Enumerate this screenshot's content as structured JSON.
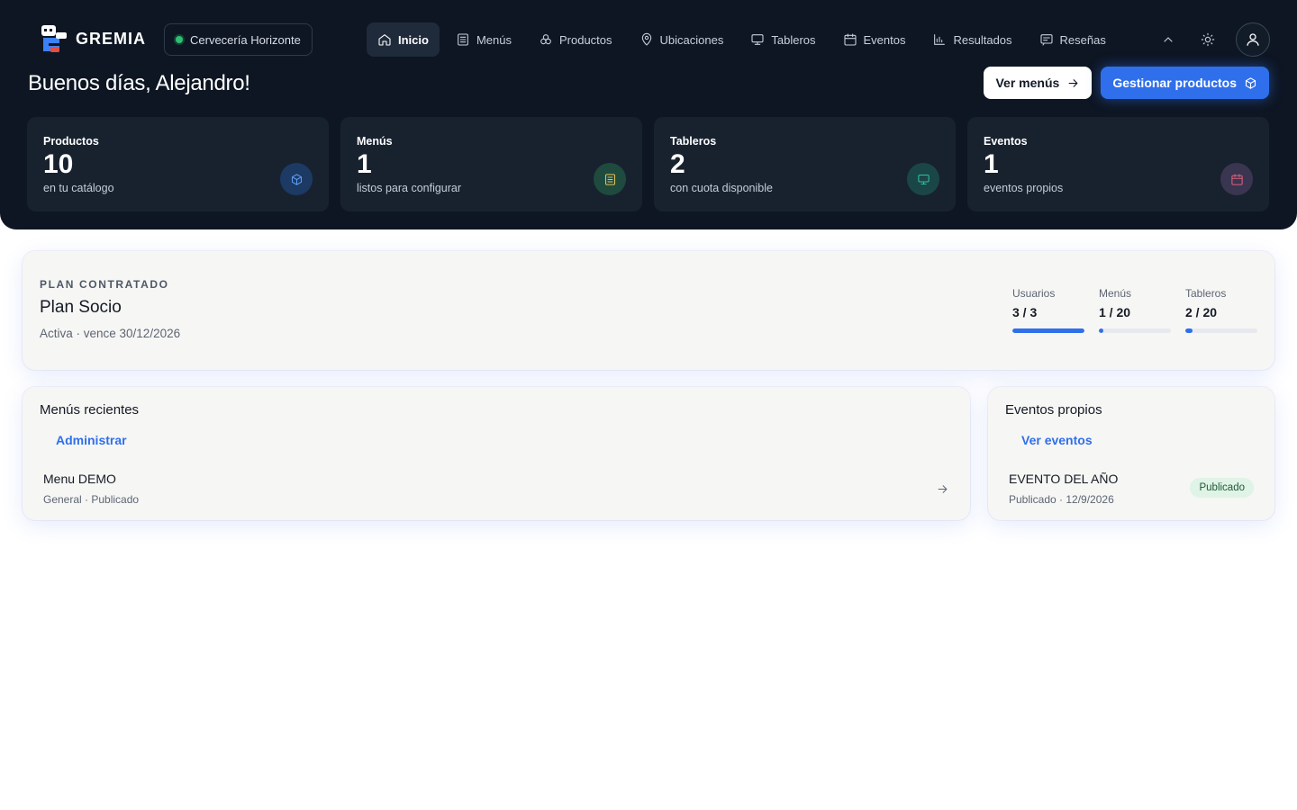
{
  "app": {
    "brand": "GREMIA"
  },
  "venue": {
    "name": "Cervecería Horizonte"
  },
  "nav": {
    "items": [
      {
        "label": "Inicio",
        "icon": "home-icon",
        "active": true
      },
      {
        "label": "Menús",
        "icon": "menu-list-icon"
      },
      {
        "label": "Productos",
        "icon": "products-icon"
      },
      {
        "label": "Ubicaciones",
        "icon": "map-pin-icon"
      },
      {
        "label": "Tableros",
        "icon": "monitor-icon"
      },
      {
        "label": "Eventos",
        "icon": "calendar-icon"
      },
      {
        "label": "Resultados",
        "icon": "bar-chart-icon"
      },
      {
        "label": "Reseñas",
        "icon": "review-icon"
      }
    ]
  },
  "header": {
    "greeting": "Buenos días, Alejandro!",
    "view_menus": "Ver menús",
    "manage_products": "Gestionar productos"
  },
  "stats": [
    {
      "label": "Productos",
      "value": "10",
      "sub": "en tu catálogo",
      "icon": "cube-icon",
      "color": "#3b82f6"
    },
    {
      "label": "Menús",
      "value": "1",
      "sub": "listos para configurar",
      "icon": "menu-list-icon",
      "color": "#e0c15a"
    },
    {
      "label": "Tableros",
      "value": "2",
      "sub": "con cuota disponible",
      "icon": "monitor-icon",
      "color": "#2fbfa0"
    },
    {
      "label": "Eventos",
      "value": "1",
      "sub": "eventos propios",
      "icon": "calendar-icon",
      "color": "#e0607a"
    }
  ],
  "plan": {
    "kicker": "PLAN CONTRATADO",
    "name": "Plan Socio",
    "status": "Activa · vence 30/12/2026",
    "usage": [
      {
        "label": "Usuarios",
        "value": "3 / 3",
        "fraction": 1.0
      },
      {
        "label": "Menús",
        "value": "1 / 20",
        "fraction": 0.05
      },
      {
        "label": "Tableros",
        "value": "2 / 20",
        "fraction": 0.1
      }
    ]
  },
  "recent_menus": {
    "title": "Menús recientes",
    "link": "Administrar",
    "items": [
      {
        "title": "Menu DEMO",
        "sub": "General · Publicado"
      }
    ]
  },
  "own_events": {
    "title": "Eventos propios",
    "link": "Ver eventos",
    "items": [
      {
        "title": "EVENTO DEL AÑO",
        "sub": "Publicado · 12/9/2026",
        "badge": "Publicado"
      }
    ]
  },
  "colors": {
    "accent": "#2f6feb",
    "hero_bg": "#0e1623",
    "stat_bg": "#18222f"
  }
}
